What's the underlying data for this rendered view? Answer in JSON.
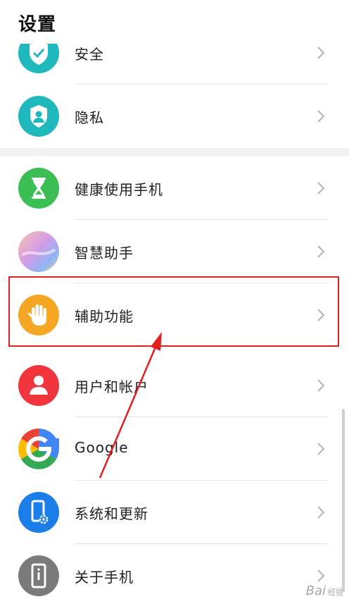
{
  "header": {
    "title": "设置"
  },
  "rows": [
    {
      "id": "security",
      "label": "安全",
      "icon": "shield-check-icon",
      "color": "#1fb8bd"
    },
    {
      "id": "privacy",
      "label": "隐私",
      "icon": "shield-person-icon",
      "color": "#1fb8bd"
    },
    {
      "id": "digital-balance",
      "label": "健康使用手机",
      "icon": "hourglass-icon",
      "color": "#3bbf55"
    },
    {
      "id": "smart-assistant",
      "label": "智慧助手",
      "icon": "gradient-orb-icon",
      "color": "#d9a0e0"
    },
    {
      "id": "accessibility",
      "label": "辅助功能",
      "icon": "hand-icon",
      "color": "#f5a623"
    },
    {
      "id": "users-accounts",
      "label": "用户和帐户",
      "icon": "user-icon",
      "color": "#f0353d"
    },
    {
      "id": "google",
      "label": "Google",
      "icon": "google-g-icon",
      "color": "#ffffff"
    },
    {
      "id": "system-update",
      "label": "系统和更新",
      "icon": "phone-gear-icon",
      "color": "#1a7de8"
    },
    {
      "id": "about-phone",
      "label": "关于手机",
      "icon": "phone-info-icon",
      "color": "#7a7a7a"
    }
  ],
  "annotation": {
    "highlight_color": "#e02020"
  },
  "watermark": {
    "text": "Bai",
    "sub": "经验"
  }
}
